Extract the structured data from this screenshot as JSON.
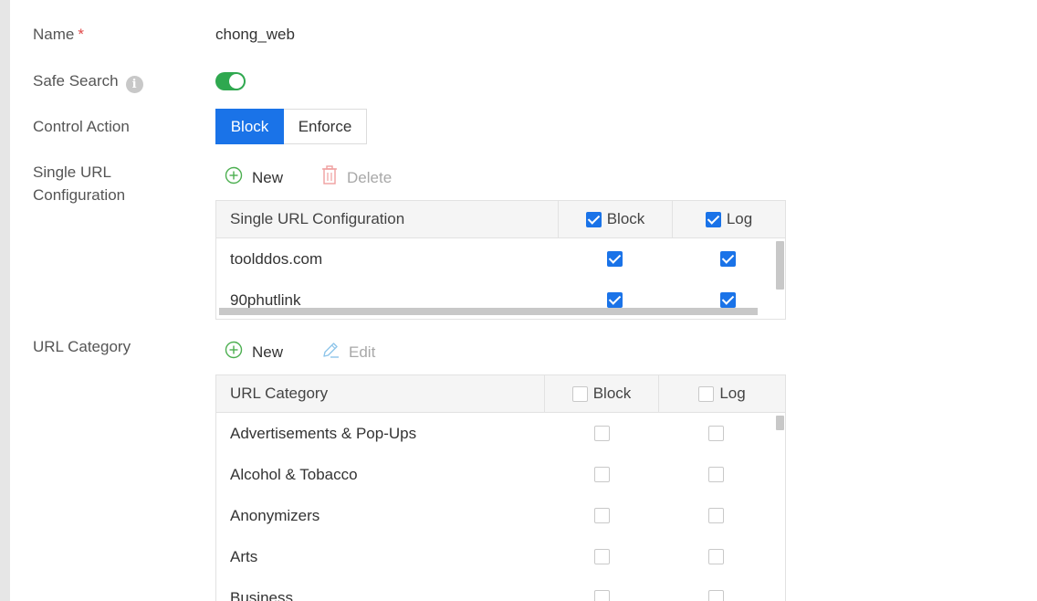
{
  "form": {
    "name_label": "Name",
    "required_mark": "*",
    "name_value": "chong_web",
    "safe_search_label": "Safe Search",
    "safe_search_on": true,
    "info_glyph": "i",
    "control_action_label": "Control Action",
    "control_action_options": [
      "Block",
      "Enforce"
    ],
    "control_action_selected": "Block",
    "single_url_label_line1": "Single URL",
    "single_url_label_line2": "Configuration",
    "url_category_label": "URL Category"
  },
  "single_url_toolbar": {
    "new_label": "New",
    "delete_label": "Delete"
  },
  "single_url_table": {
    "headers": [
      "Single URL Configuration",
      "Block",
      "Log"
    ],
    "header_block_checked": true,
    "header_log_checked": true,
    "rows": [
      {
        "url": "toolddos.com",
        "block": true,
        "log": true
      },
      {
        "url": "90phutlink",
        "block": true,
        "log": true
      }
    ]
  },
  "url_category_toolbar": {
    "new_label": "New",
    "edit_label": "Edit"
  },
  "url_category_table": {
    "headers": [
      "URL Category",
      "Block",
      "Log"
    ],
    "header_block_checked": false,
    "header_log_checked": false,
    "rows": [
      {
        "category": "Advertisements & Pop-Ups",
        "block": false,
        "log": false
      },
      {
        "category": "Alcohol & Tobacco",
        "block": false,
        "log": false
      },
      {
        "category": "Anonymizers",
        "block": false,
        "log": false
      },
      {
        "category": "Arts",
        "block": false,
        "log": false
      },
      {
        "category": "Business",
        "block": false,
        "log": false
      }
    ]
  },
  "colors": {
    "accent_blue": "#1a73e8",
    "toggle_green": "#2fa84f",
    "required_red": "#e04848",
    "new_icon_green": "#4caf50",
    "delete_icon_red": "#f0a0a0",
    "edit_icon_blue": "#8ec5ea"
  }
}
